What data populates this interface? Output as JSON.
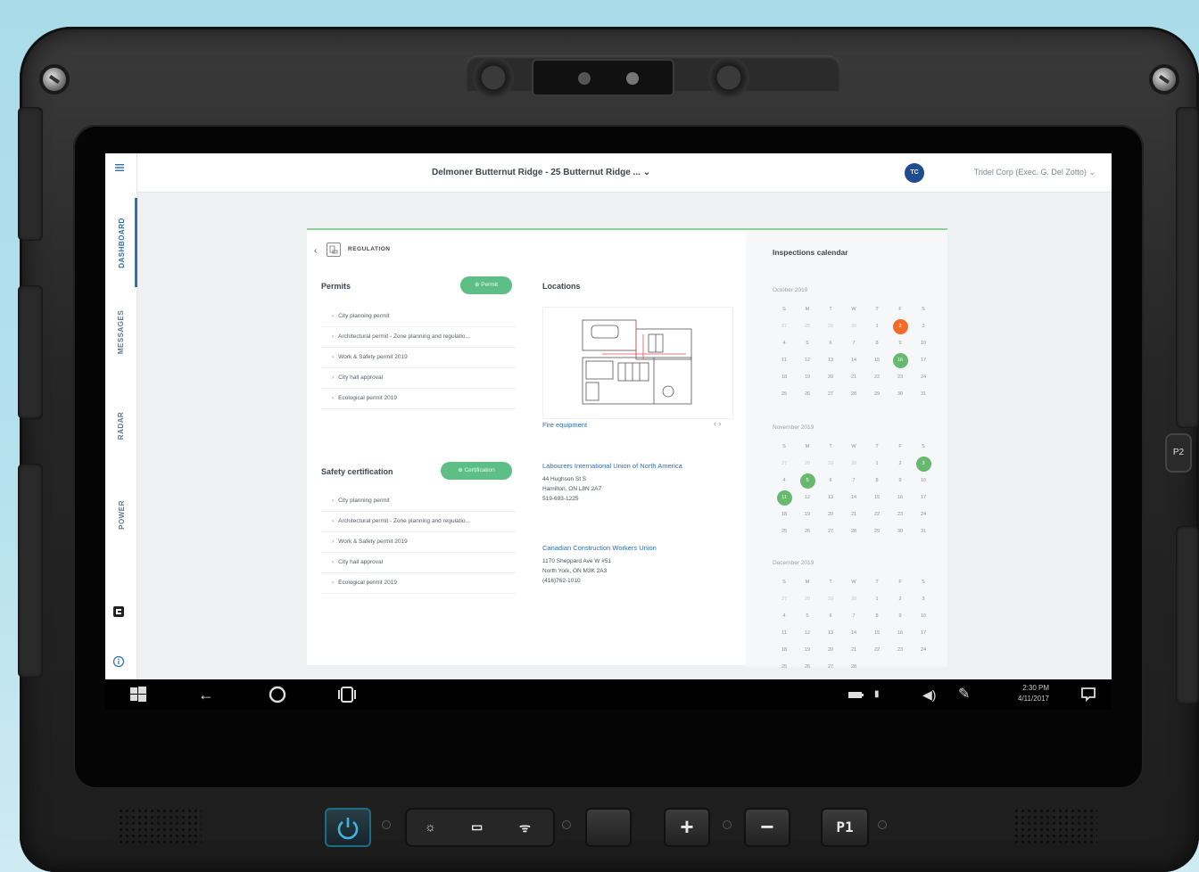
{
  "app": {
    "title": "Delmoner Butternut Ridge - 25 Butternut Ridge ...",
    "org": "Tridel Corp (Exec. G. Del Zotto)",
    "avatar": "TC"
  },
  "rail": {
    "tabs": [
      "DASHBOARD",
      "MESSAGES",
      "RADAR",
      "POWER"
    ],
    "active": "DASHBOARD"
  },
  "page": {
    "section": "REGULATION",
    "permits": {
      "title": "Permits",
      "button": "Permit",
      "items": [
        "City planning permit",
        "Architectural permit - Zone planning and regulatio...",
        "Work & Safety permit 2019",
        "City hall approval",
        "Ecological permit 2019"
      ]
    },
    "safety": {
      "title": "Safety certification",
      "button": "Certification",
      "items": [
        "City planning permit",
        "Architectural permit - Zone planning and regulatio...",
        "Work & Safety permit 2019",
        "City hall approval",
        "Ecological permit 2019"
      ]
    },
    "locations": {
      "title": "Locations",
      "plan_caption": "Fire equipment",
      "contacts": [
        {
          "name": "Labourers International Union of North America",
          "line1": "44 Hughson St S",
          "line2": "Hamilton, ON L8N 2A7",
          "line3": "519-693-1225"
        },
        {
          "name": "Canadian Construction Workers Union",
          "line1": "1170 Sheppard Ave W #51",
          "line2": "North York, ON M3K 2A3",
          "line3": "(416)762-1010"
        }
      ]
    },
    "calendar": {
      "title": "Inspections calendar",
      "weekdays": [
        "S",
        "M",
        "T",
        "W",
        "T",
        "F",
        "S"
      ],
      "months": [
        {
          "label": "October 2019",
          "days": [
            "27",
            "28",
            "29",
            "30",
            "1",
            "2",
            "3",
            "4",
            "5",
            "6",
            "7",
            "8",
            "9",
            "10",
            "11",
            "12",
            "13",
            "14",
            "15",
            "16",
            "17",
            "18",
            "19",
            "20",
            "21",
            "22",
            "23",
            "24",
            "25",
            "26",
            "27",
            "28",
            "29",
            "30",
            "31"
          ],
          "muted": [
            0,
            1,
            2,
            3
          ],
          "orange": [
            5
          ],
          "green": [
            19
          ]
        },
        {
          "label": "November 2019",
          "days": [
            "27",
            "28",
            "29",
            "30",
            "1",
            "2",
            "3",
            "4",
            "5",
            "6",
            "7",
            "8",
            "9",
            "10",
            "11",
            "12",
            "13",
            "14",
            "15",
            "16",
            "17",
            "18",
            "19",
            "20",
            "21",
            "22",
            "23",
            "24",
            "25",
            "26",
            "27",
            "28",
            "29",
            "30",
            "31"
          ],
          "muted": [
            0,
            1,
            2,
            3
          ],
          "orange": [],
          "green": [
            6,
            8,
            14
          ]
        },
        {
          "label": "December 2019",
          "days": [
            "27",
            "28",
            "29",
            "30",
            "1",
            "2",
            "3",
            "4",
            "5",
            "6",
            "7",
            "8",
            "9",
            "10",
            "11",
            "12",
            "13",
            "14",
            "15",
            "16",
            "17",
            "18",
            "19",
            "20",
            "21",
            "22",
            "23",
            "24",
            "25",
            "26",
            "27",
            "28"
          ],
          "muted": [
            0,
            1,
            2,
            3
          ],
          "orange": [],
          "green": []
        }
      ]
    }
  },
  "taskbar": {
    "time": "2:30 PM",
    "date": "4/11/2017"
  },
  "hardware": {
    "plus": "+",
    "minus": "−",
    "p1": "P1",
    "p2": "P2"
  }
}
